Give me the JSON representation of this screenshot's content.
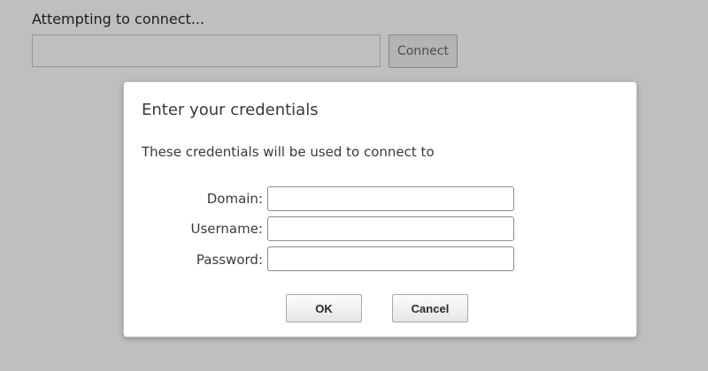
{
  "background": {
    "status_text": "Attempting to connect...",
    "address_input": {
      "value": "",
      "placeholder": ""
    },
    "connect_label": "Connect"
  },
  "dialog": {
    "title": "Enter your credentials",
    "message": "These credentials will be used to connect to",
    "fields": {
      "domain": {
        "label": "Domain:",
        "value": ""
      },
      "username": {
        "label": "Username:",
        "value": ""
      },
      "password": {
        "label": "Password:",
        "value": ""
      }
    },
    "ok_label": "OK",
    "cancel_label": "Cancel"
  }
}
